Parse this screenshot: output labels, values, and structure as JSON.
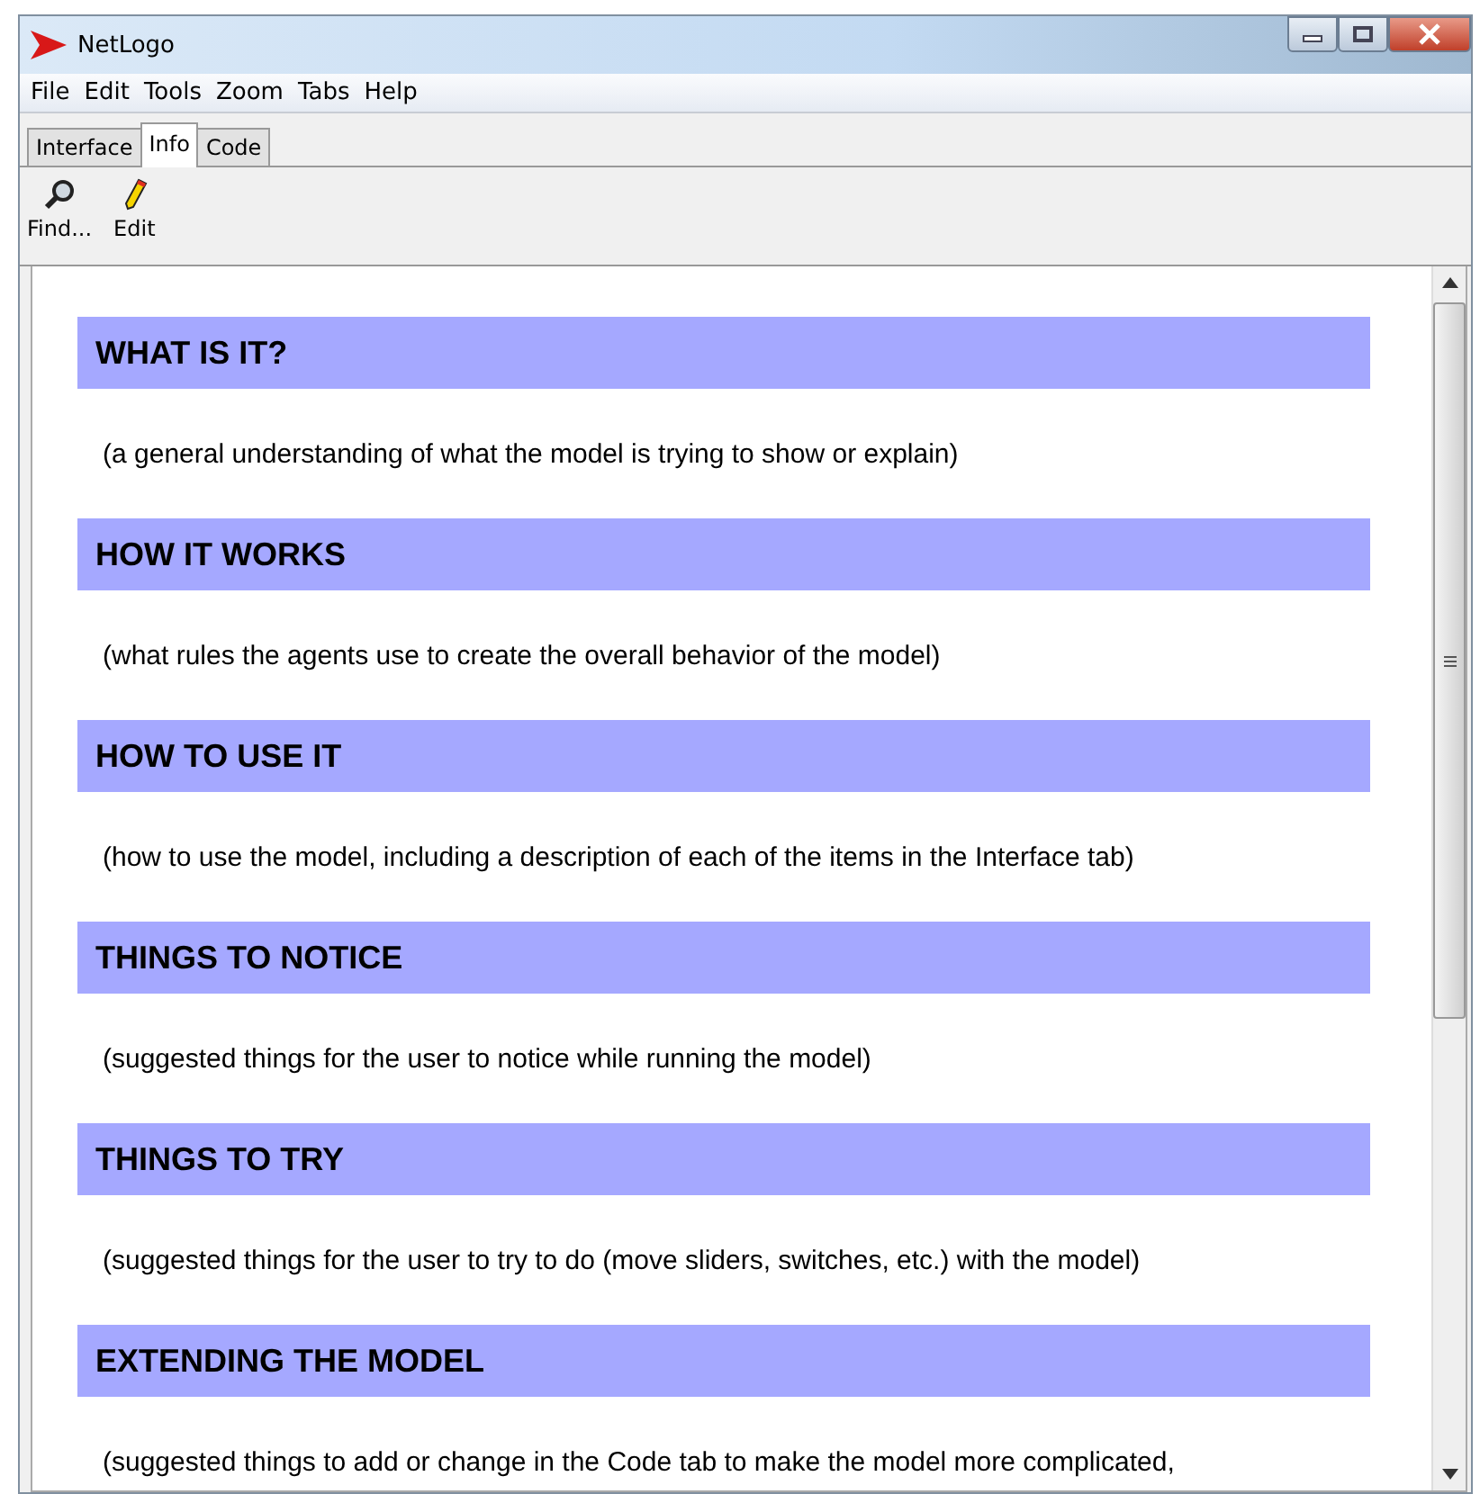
{
  "window": {
    "title": "NetLogo"
  },
  "menu": [
    "File",
    "Edit",
    "Tools",
    "Zoom",
    "Tabs",
    "Help"
  ],
  "tabs": [
    {
      "label": "Interface",
      "selected": false
    },
    {
      "label": "Info",
      "selected": true
    },
    {
      "label": "Code",
      "selected": false
    }
  ],
  "toolbar": [
    {
      "kind": "find",
      "label": "Find..."
    },
    {
      "kind": "edit",
      "label": "Edit"
    }
  ],
  "sections": [
    {
      "heading": "WHAT IS IT?",
      "text": "(a general understanding of what the model is trying to show or explain)"
    },
    {
      "heading": "HOW IT WORKS",
      "text": "(what rules the agents use to create the overall behavior of the model)"
    },
    {
      "heading": "HOW TO USE IT",
      "text": "(how to use the model, including a description of each of the items in the Interface tab)"
    },
    {
      "heading": "THINGS TO NOTICE",
      "text": "(suggested things for the user to notice while running the model)"
    },
    {
      "heading": "THINGS TO TRY",
      "text": "(suggested things for the user to try to do (move sliders, switches, etc.) with the model)"
    },
    {
      "heading": "EXTENDING THE MODEL",
      "text": "(suggested things to add or change in the Code tab to make the model more complicated,"
    }
  ]
}
